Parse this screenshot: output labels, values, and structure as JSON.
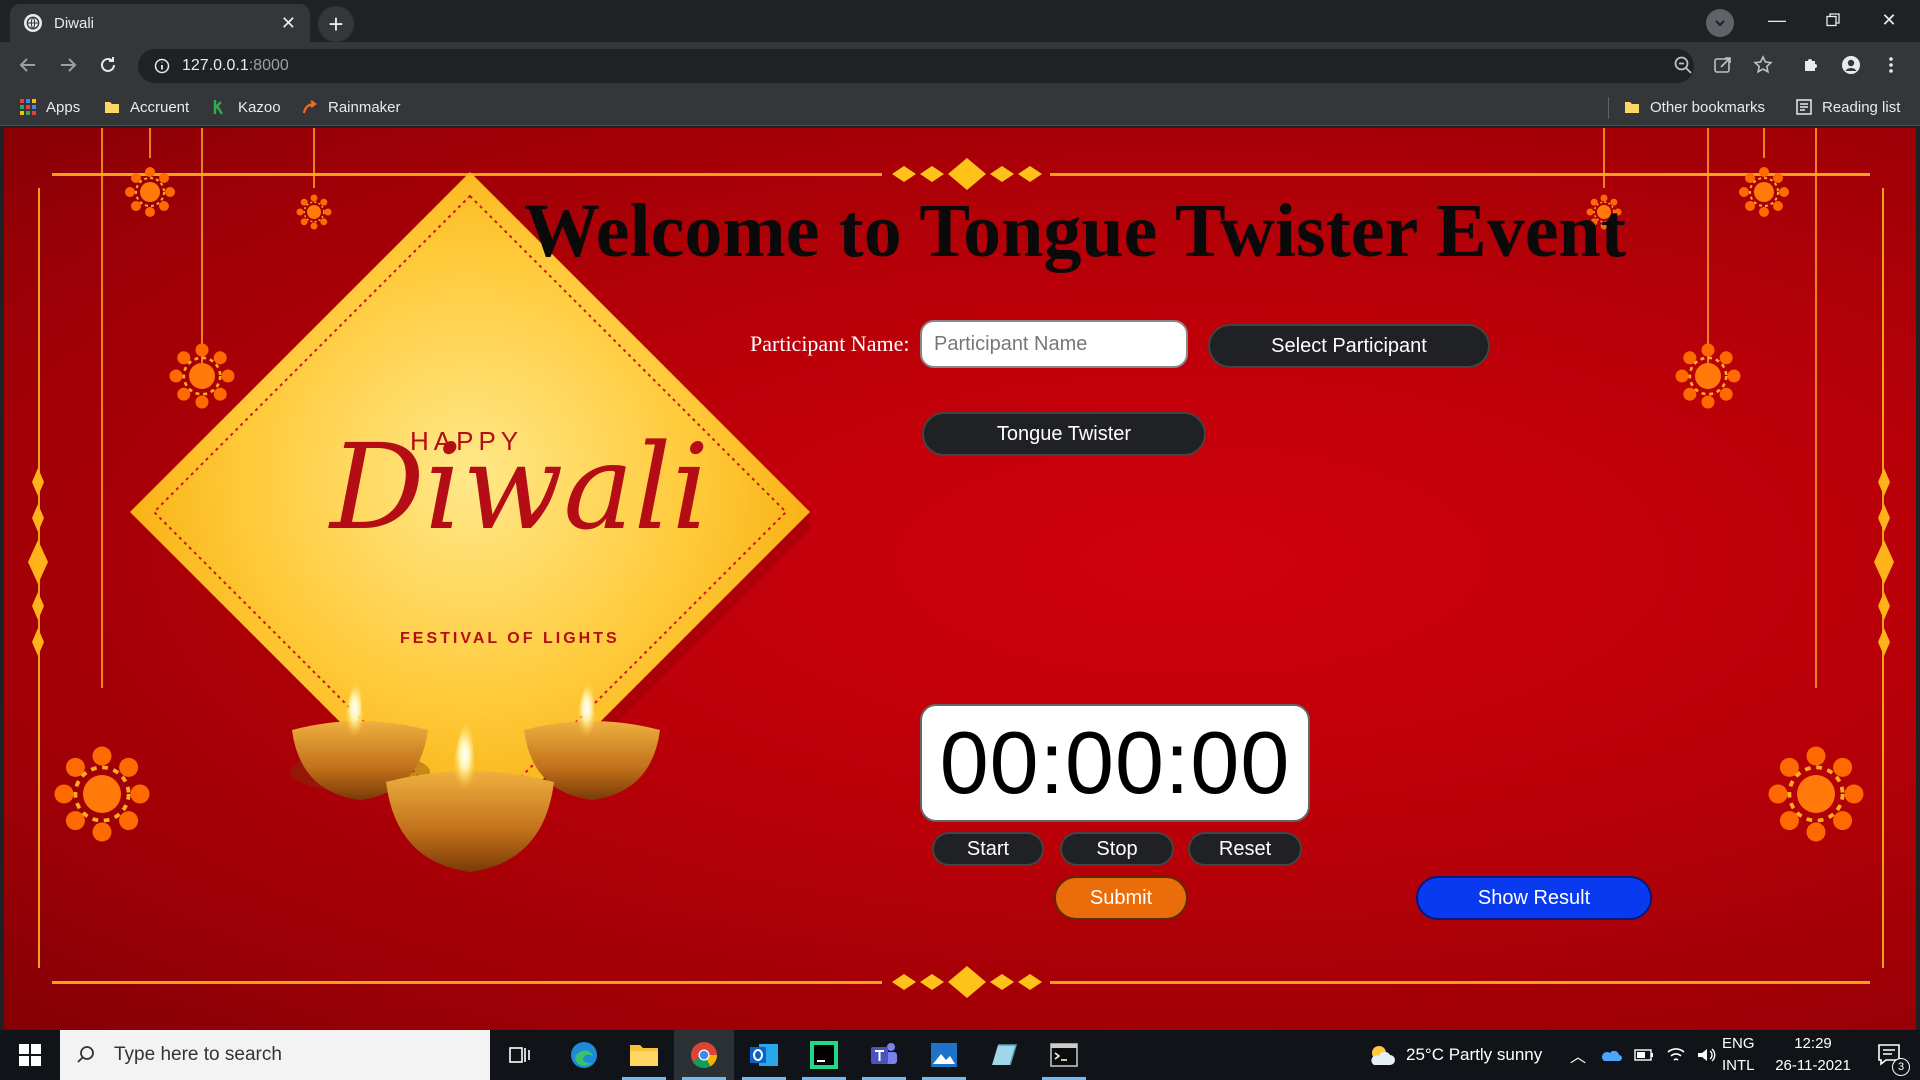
{
  "browser": {
    "tab_title": "Diwali",
    "url_host": "127.0.0.1",
    "url_port": ":8000",
    "bookmarks": [
      "Apps",
      "Accruent",
      "Kazoo",
      "Rainmaker"
    ],
    "bookmarks_right": [
      "Other bookmarks",
      "Reading list"
    ]
  },
  "page": {
    "title": "Welcome to Tongue Twister Event",
    "participant_label": "Participant Name:",
    "participant_placeholder": "Participant Name",
    "select_participant": "Select Participant",
    "tongue_twister": "Tongue Twister",
    "timer": "00:00:00",
    "start": "Start",
    "stop": "Stop",
    "reset": "Reset",
    "submit": "Submit",
    "show_result": "Show Result",
    "banner_happy": "HAPPY",
    "banner_diwali": "Diwali",
    "banner_festival": "FESTIVAL OF LIGHTS"
  },
  "colors": {
    "background_red": "#b80008",
    "gold": "#f0a21a",
    "submit_orange": "#ea6d0a",
    "result_blue": "#0a3af0"
  },
  "taskbar": {
    "search_placeholder": "Type here to search",
    "weather": "25°C  Partly sunny",
    "lang_1": "ENG",
    "lang_2": "INTL",
    "time": "12:29",
    "date": "26-11-2021",
    "notifications": "3"
  }
}
